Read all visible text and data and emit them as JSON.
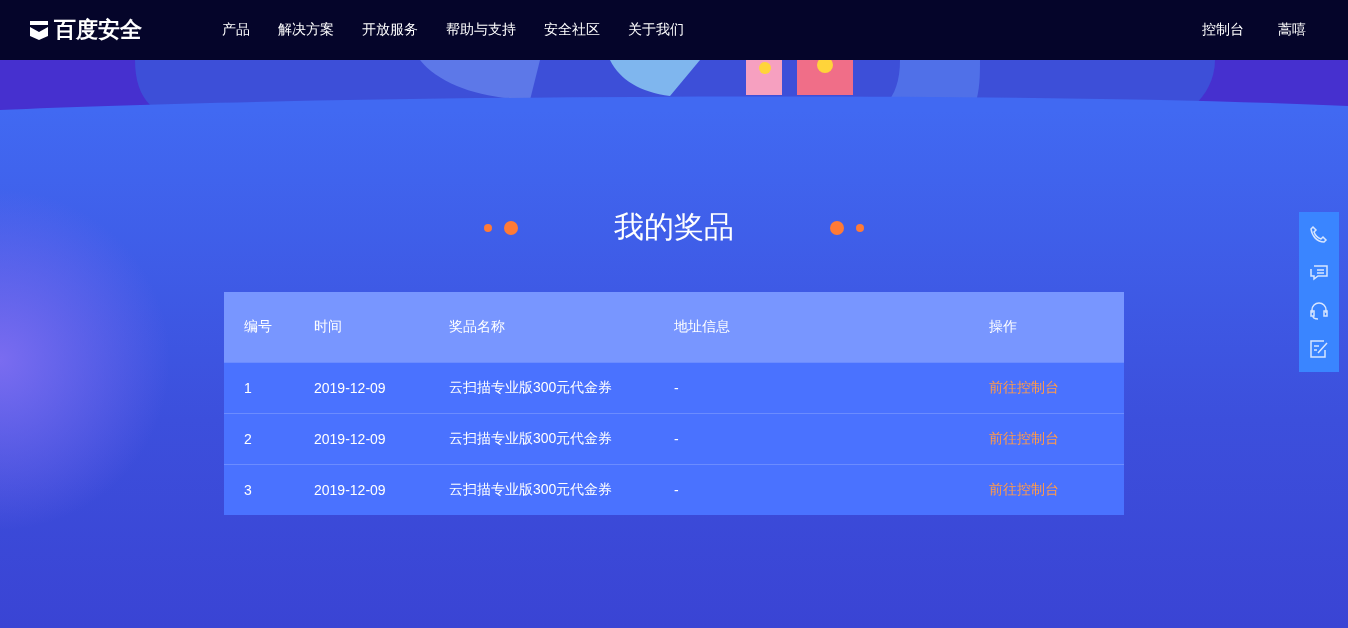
{
  "header": {
    "logo": "百度安全",
    "nav": [
      "产品",
      "解决方案",
      "开放服务",
      "帮助与支持",
      "安全社区",
      "关于我们"
    ],
    "right_links": [
      "控制台",
      "蒿嘻"
    ]
  },
  "title": "我的奖品",
  "table": {
    "columns": [
      "编号",
      "时间",
      "奖品名称",
      "地址信息",
      "操作"
    ],
    "rows": [
      {
        "number": "1",
        "time": "2019-12-09",
        "prize": "云扫描专业版300元代金券",
        "address": "-",
        "action": "前往控制台"
      },
      {
        "number": "2",
        "time": "2019-12-09",
        "prize": "云扫描专业版300元代金券",
        "address": "-",
        "action": "前往控制台"
      },
      {
        "number": "3",
        "time": "2019-12-09",
        "prize": "云扫描专业版300元代金券",
        "address": "-",
        "action": "前往控制台"
      }
    ]
  },
  "side_toolbar": [
    {
      "kind": "phone"
    },
    {
      "kind": "chat"
    },
    {
      "kind": "headset"
    },
    {
      "kind": "edit"
    }
  ]
}
